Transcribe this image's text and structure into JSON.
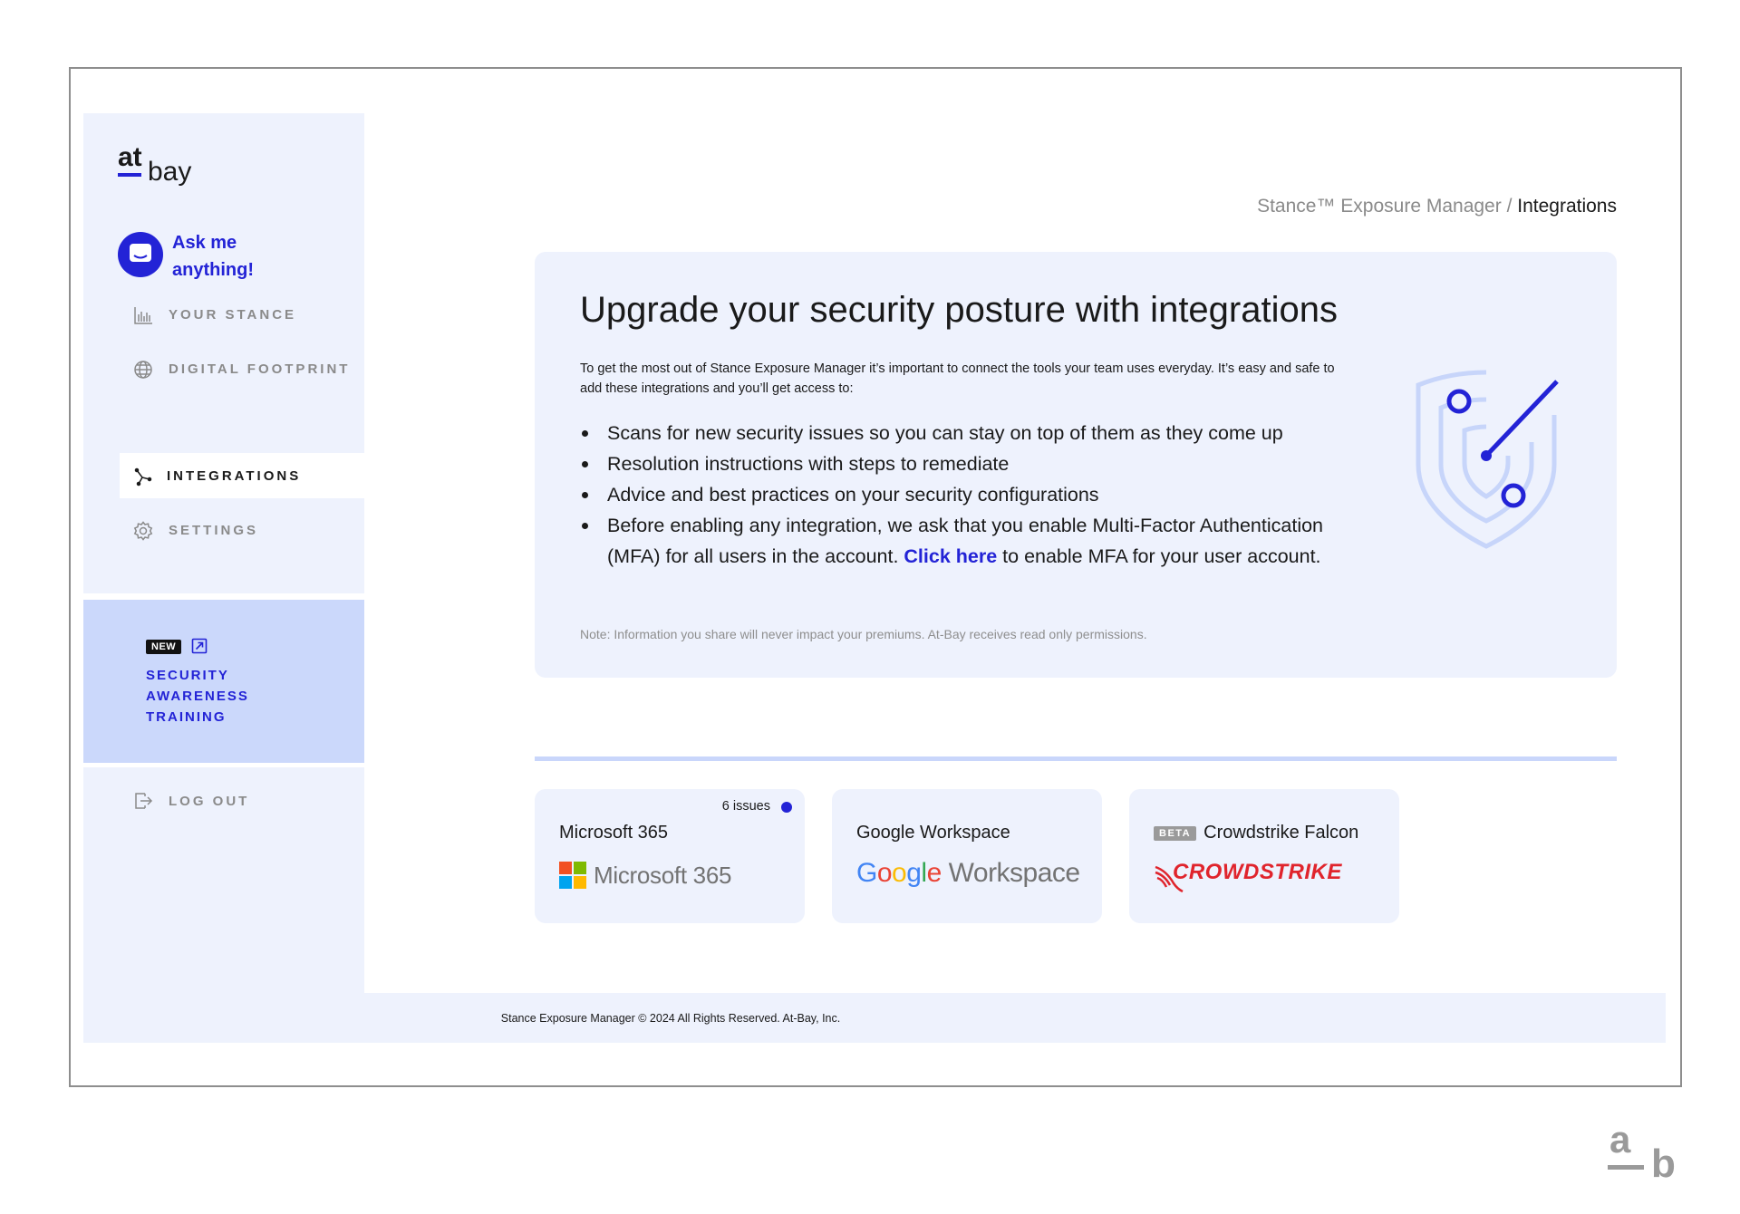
{
  "brand": {
    "logo_top": "at",
    "logo_bottom": "bay",
    "accent": "#2323d6"
  },
  "assistant": {
    "label": "Ask me anything!",
    "icon": "chat-bubble-icon"
  },
  "nav": {
    "items": [
      {
        "label": "YOUR STANCE",
        "icon": "bar-chart-icon",
        "active": false
      },
      {
        "label": "DIGITAL FOOTPRINT",
        "icon": "globe-icon",
        "active": false
      },
      {
        "label": "INTEGRATIONS",
        "icon": "integrations-icon",
        "active": true
      },
      {
        "label": "SETTINGS",
        "icon": "gear-icon",
        "active": false
      }
    ],
    "logout": {
      "label": "LOG OUT",
      "icon": "logout-icon"
    }
  },
  "promo": {
    "badge": "NEW",
    "title": "SECURITY AWARENESS TRAINING",
    "icon": "external-link-icon"
  },
  "breadcrumb": {
    "parent": "Stance™ Exposure Manager",
    "separator": " / ",
    "current": "Integrations"
  },
  "hero": {
    "title": "Upgrade your security posture with integrations",
    "intro": "To get the most out of Stance Exposure Manager it’s important to connect the tools your team uses everyday. It’s easy and safe to add these integrations and you’ll get access to:",
    "bullets": [
      "Scans for new security issues so you can stay on top of them as they come up",
      "Resolution instructions with steps to remediate",
      "Advice and best practices on your security configurations"
    ],
    "mfa": {
      "before": "Before enabling any integration, we ask that you enable Multi-Factor Authentication (MFA) for all users in the account. ",
      "link": "Click here",
      "after": " to enable MFA for your user account."
    },
    "note": "Note: Information you share will never impact your premiums. At-Bay receives read only permissions.",
    "illustration": "shield-icon"
  },
  "integrations": [
    {
      "name": "Microsoft 365",
      "issues": "6 issues",
      "logo_text": "Microsoft 365"
    },
    {
      "name": "Google Workspace",
      "logo_google": [
        "G",
        "o",
        "o",
        "g",
        "l",
        "e"
      ],
      "logo_suffix": "Workspace"
    },
    {
      "name": "Crowdstrike Falcon",
      "badge": "BETA",
      "logo_text": "CROWDSTRIKE"
    }
  ],
  "footer": {
    "text": "Stance Exposure Manager © 2024 All Rights Reserved. At-Bay, Inc."
  },
  "corner_logo": {
    "top": "a",
    "bottom": "b"
  }
}
